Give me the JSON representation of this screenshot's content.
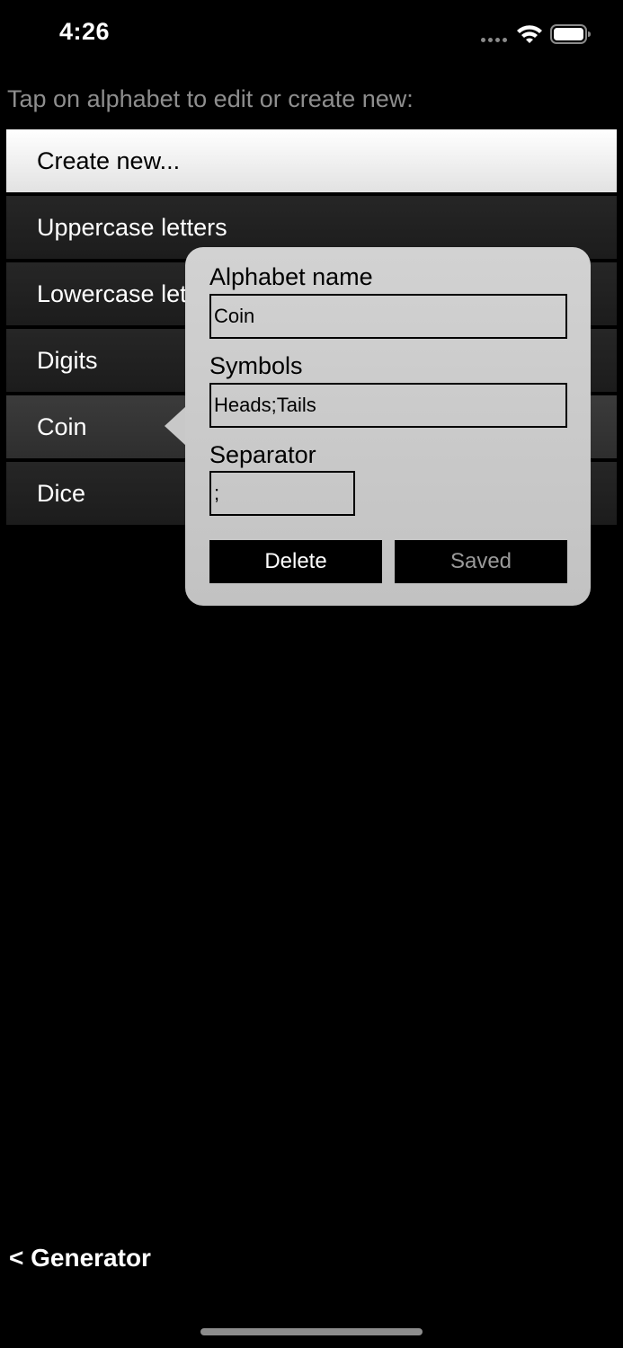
{
  "status_bar": {
    "time": "4:26"
  },
  "instructions": "Tap on alphabet to edit or create new:",
  "alphabets": [
    {
      "label": "Create new..."
    },
    {
      "label": "Uppercase letters"
    },
    {
      "label": "Lowercase letters"
    },
    {
      "label": "Digits"
    },
    {
      "label": "Coin"
    },
    {
      "label": "Dice"
    }
  ],
  "editor": {
    "name_label": "Alphabet name",
    "name_value": "Coin",
    "symbols_label": "Symbols",
    "symbols_value": "Heads;Tails",
    "separator_label": "Separator",
    "separator_value": ";",
    "delete_label": "Delete",
    "saved_label": "Saved"
  },
  "nav": {
    "back_label": "< Generator"
  },
  "colors": {
    "background": "#000000",
    "popover": "#c8c8c8",
    "muted_text": "#8e8e8e"
  }
}
